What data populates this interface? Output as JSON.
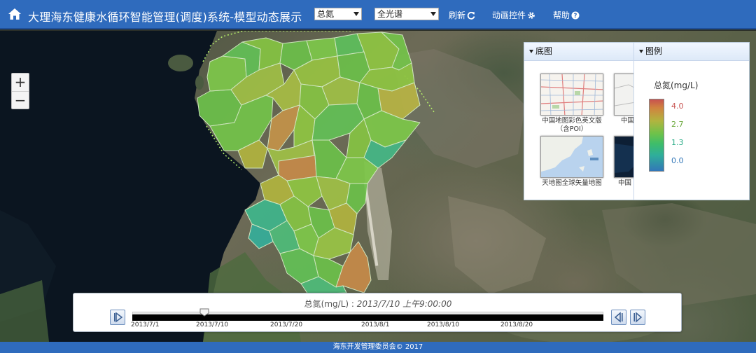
{
  "header": {
    "title": "大理海东健康水循环智能管理(调度)系统-模型动态展示",
    "indicator_select": "总氮",
    "spectrum_select": "全光谱",
    "refresh_label": "刷新",
    "animation_label": "动画控件",
    "help_label": "帮助"
  },
  "map": {
    "zoom_in": "+",
    "zoom_out": "−"
  },
  "basemap_panel": {
    "title": "底图",
    "items": [
      {
        "label": "中国地图彩色英文版（含POI）"
      },
      {
        "label": "中国"
      },
      {
        "label": "天地图全球矢量地图"
      },
      {
        "label": "中国"
      }
    ]
  },
  "legend_panel": {
    "title": "图例",
    "unit_label": "总氮(mg/L)",
    "ticks": [
      "4.0",
      "2.7",
      "1.3",
      "0.0"
    ],
    "colors": {
      "high": "#c8524f",
      "mid": "#6dc24a",
      "low": "#3277b8"
    }
  },
  "timeline": {
    "label_prefix": "总氮(mg/L) : ",
    "current_time": "2013/7/10 上午9:00:00",
    "ticks": [
      "2013/7/1",
      "2013/7/10",
      "2013/7/20",
      "2013/8/1",
      "2013/8/10",
      "2013/8/20"
    ]
  },
  "footer": {
    "text": "海东开发管理委员会© 2017"
  },
  "theme": {
    "header_blue": "#2f6bbd"
  }
}
